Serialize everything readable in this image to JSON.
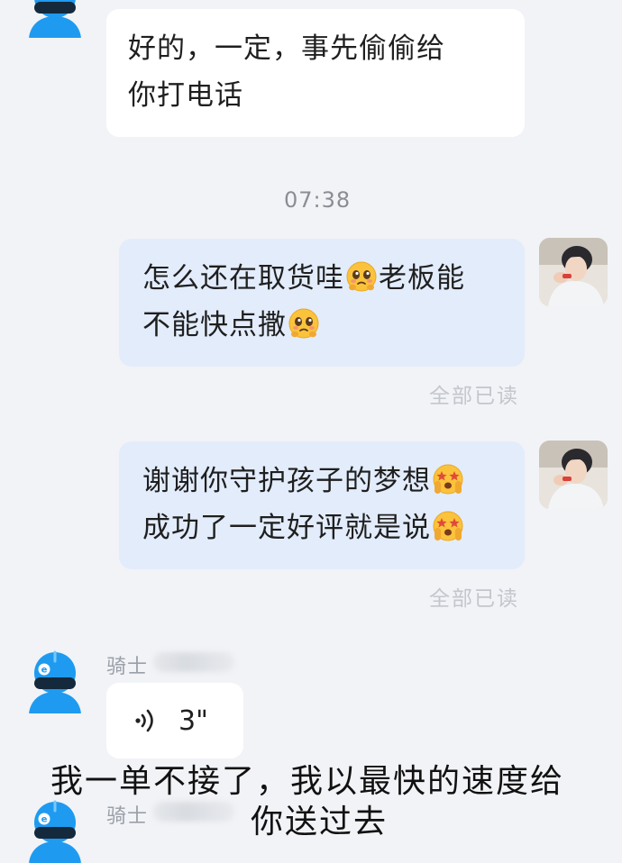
{
  "messages": {
    "incoming_1": {
      "lines": [
        "好的，一定，事先偷偷给",
        "你打电话"
      ]
    },
    "time_divider": "07:38",
    "outgoing_1": {
      "line1_text": "怎么还在取货哇",
      "line1_after": "老板能",
      "line2_text": "不能快点撒",
      "status": "全部已读"
    },
    "outgoing_2": {
      "line1_text": "谢谢你守护孩子的梦想",
      "line2_text": "成功了一定好评就是说",
      "status": "全部已读"
    },
    "rider_label": "骑士",
    "voice_message": {
      "duration": "3\""
    }
  },
  "caption": {
    "line1": "我一单不接了，我以最快的速度给",
    "line2": "你送过去"
  },
  "icons": {
    "rider_avatar": "delivery-rider-helmet-icon",
    "user_avatar": "user-photo-avatar",
    "pleading_emoji": "pleading-face-emoji",
    "starstruck_emoji": "star-struck-face-emoji",
    "voice_wave": "voice-wave-icon"
  },
  "colors": {
    "background": "#f2f3f7",
    "incoming_bubble": "#ffffff",
    "outgoing_bubble": "#e3ecfb",
    "rider_blue": "#1e9bf0"
  }
}
